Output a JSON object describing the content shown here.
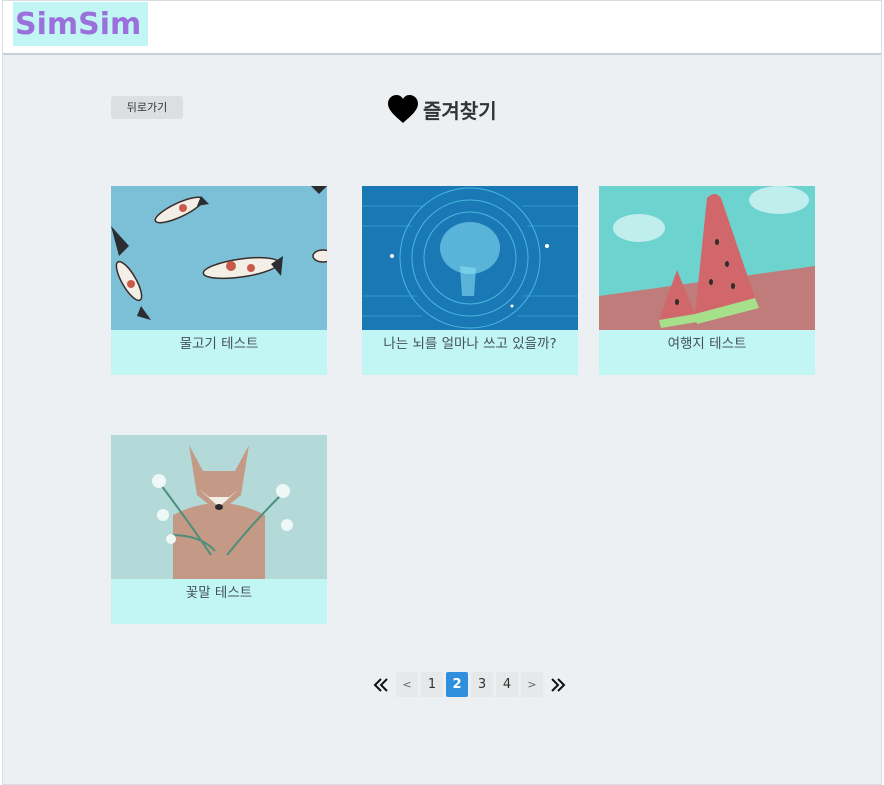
{
  "header": {
    "logo": "SimSim"
  },
  "toolbar": {
    "back_label": "뒤로가기"
  },
  "page": {
    "title": "즐겨찾기"
  },
  "cards": [
    {
      "label": "물고기 테스트"
    },
    {
      "label": "나는 뇌를 얼마나 쓰고 있을까?"
    },
    {
      "label": "여행지 테스트"
    },
    {
      "label": "꽃말 테스트"
    }
  ],
  "pagination": {
    "prev": "<",
    "next": ">",
    "pages": [
      "1",
      "2",
      "3",
      "4"
    ],
    "current": "2"
  },
  "colors": {
    "accent": "#2f8fdc",
    "logo_text": "#9a70db",
    "logo_bg": "#c2f6f4",
    "card_bg": "#c2f6f4",
    "page_bg": "#ecf0f3"
  }
}
